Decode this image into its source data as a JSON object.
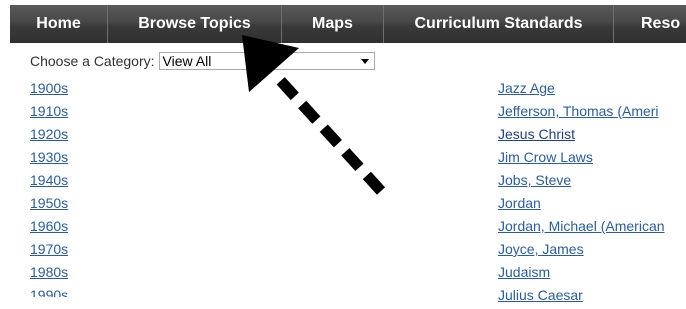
{
  "nav": {
    "items": [
      {
        "label": "Home"
      },
      {
        "label": "Browse Topics"
      },
      {
        "label": "Maps"
      },
      {
        "label": "Curriculum Standards"
      },
      {
        "label": "Reso"
      }
    ]
  },
  "category": {
    "label": "Choose a Category:",
    "selected": "View All"
  },
  "left_links": [
    "1900s",
    "1910s",
    "1920s",
    "1930s",
    "1940s",
    "1950s",
    "1960s",
    "1970s",
    "1980s"
  ],
  "left_partial": "1990s",
  "right_links": [
    "Jazz Age",
    "Jefferson, Thomas (Ameri",
    "Jesus Christ",
    "Jim Crow Laws",
    "Jobs, Steve",
    "Jordan",
    "Jordan, Michael (American",
    "Joyce, James",
    "Judaism",
    "Julius Caesar"
  ],
  "colors": {
    "link": "#2a5d9f",
    "visited_link": "#1f3f86",
    "nav_bg": "#3f3f3f",
    "arrow": "#000000"
  },
  "annotation": {
    "type": "dashed-arrow",
    "points_to": "Browse Topics"
  }
}
